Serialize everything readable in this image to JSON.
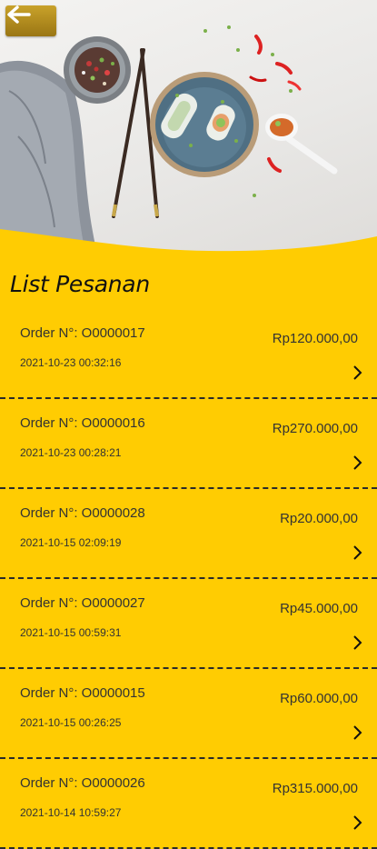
{
  "header": {
    "back_icon": "arrow-left-icon",
    "accent_color": "#FFCC02",
    "back_button_color": "#B38C1F"
  },
  "list": {
    "title": "List Pesanan",
    "chevron_icon": "chevron-right-icon",
    "orders": [
      {
        "number": "Order N°: O0000017",
        "date": "2021-10-23 00:32:16",
        "total": "Rp120.000,00"
      },
      {
        "number": "Order N°: O0000016",
        "date": "2021-10-23 00:28:21",
        "total": "Rp270.000,00"
      },
      {
        "number": "Order N°: O0000028",
        "date": "2021-10-15 02:09:19",
        "total": "Rp20.000,00"
      },
      {
        "number": "Order N°: O0000027",
        "date": "2021-10-15 00:59:31",
        "total": "Rp45.000,00"
      },
      {
        "number": "Order N°: O0000015",
        "date": "2021-10-15 00:26:25",
        "total": "Rp60.000,00"
      },
      {
        "number": "Order N°: O0000026",
        "date": "2021-10-14 10:59:27",
        "total": "Rp315.000,00"
      }
    ]
  }
}
